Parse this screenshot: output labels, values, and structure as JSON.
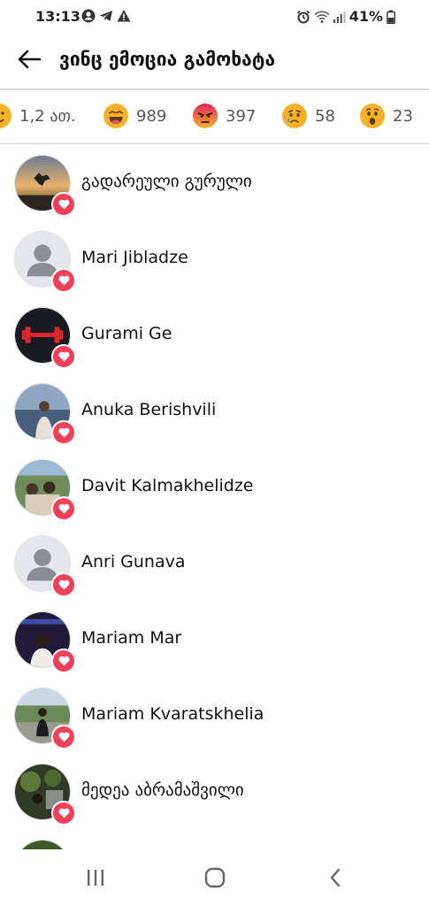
{
  "status_bar": {
    "time": "13:13",
    "battery": "41%",
    "left_icons": [
      "account-circle-icon",
      "telegram-icon",
      "warning-icon"
    ],
    "right_icons": [
      "alarm-icon",
      "wifi-icon",
      "signal-icon",
      "battery-icon"
    ]
  },
  "header": {
    "title": "ვინც ემოცია გამოხატა",
    "back_icon": "arrow-left-icon"
  },
  "reaction_tabs": [
    {
      "emoji": "care",
      "count": "1,2 ათ."
    },
    {
      "emoji": "haha",
      "count": "989"
    },
    {
      "emoji": "angry",
      "count": "397"
    },
    {
      "emoji": "sad",
      "count": "58"
    },
    {
      "emoji": "wow",
      "count": "23"
    }
  ],
  "people": [
    {
      "name": "გადარეული გურული",
      "avatar": "sunset-jump-photo",
      "reaction": "love"
    },
    {
      "name": "Mari Jibladze",
      "avatar": "default-silhouette",
      "reaction": "love"
    },
    {
      "name": "Gurami Ge",
      "avatar": "red-dumbbell-photo",
      "reaction": "love"
    },
    {
      "name": "Anuka Berishvili",
      "avatar": "seaside-portrait-photo",
      "reaction": "love"
    },
    {
      "name": "Davit Kalmakhelidze",
      "avatar": "group-outdoor-photo",
      "reaction": "love"
    },
    {
      "name": "Anri Gunava",
      "avatar": "default-silhouette",
      "reaction": "love"
    },
    {
      "name": "Mariam Mar",
      "avatar": "night-portrait-photo",
      "reaction": "love"
    },
    {
      "name": "Mariam Kvaratskhelia",
      "avatar": "park-portrait-photo",
      "reaction": "love"
    },
    {
      "name": "მედეა აბრამაშვილი",
      "avatar": "garden-photo",
      "reaction": "love"
    }
  ],
  "nav_bar": {
    "icons": [
      "recent-apps-icon",
      "home-icon",
      "back-icon"
    ]
  },
  "colors": {
    "love_badge": "#f33e58",
    "emoji_yellow": "#f7b125",
    "angry_red": "#e9710f",
    "divider": "#d8d8d8"
  }
}
